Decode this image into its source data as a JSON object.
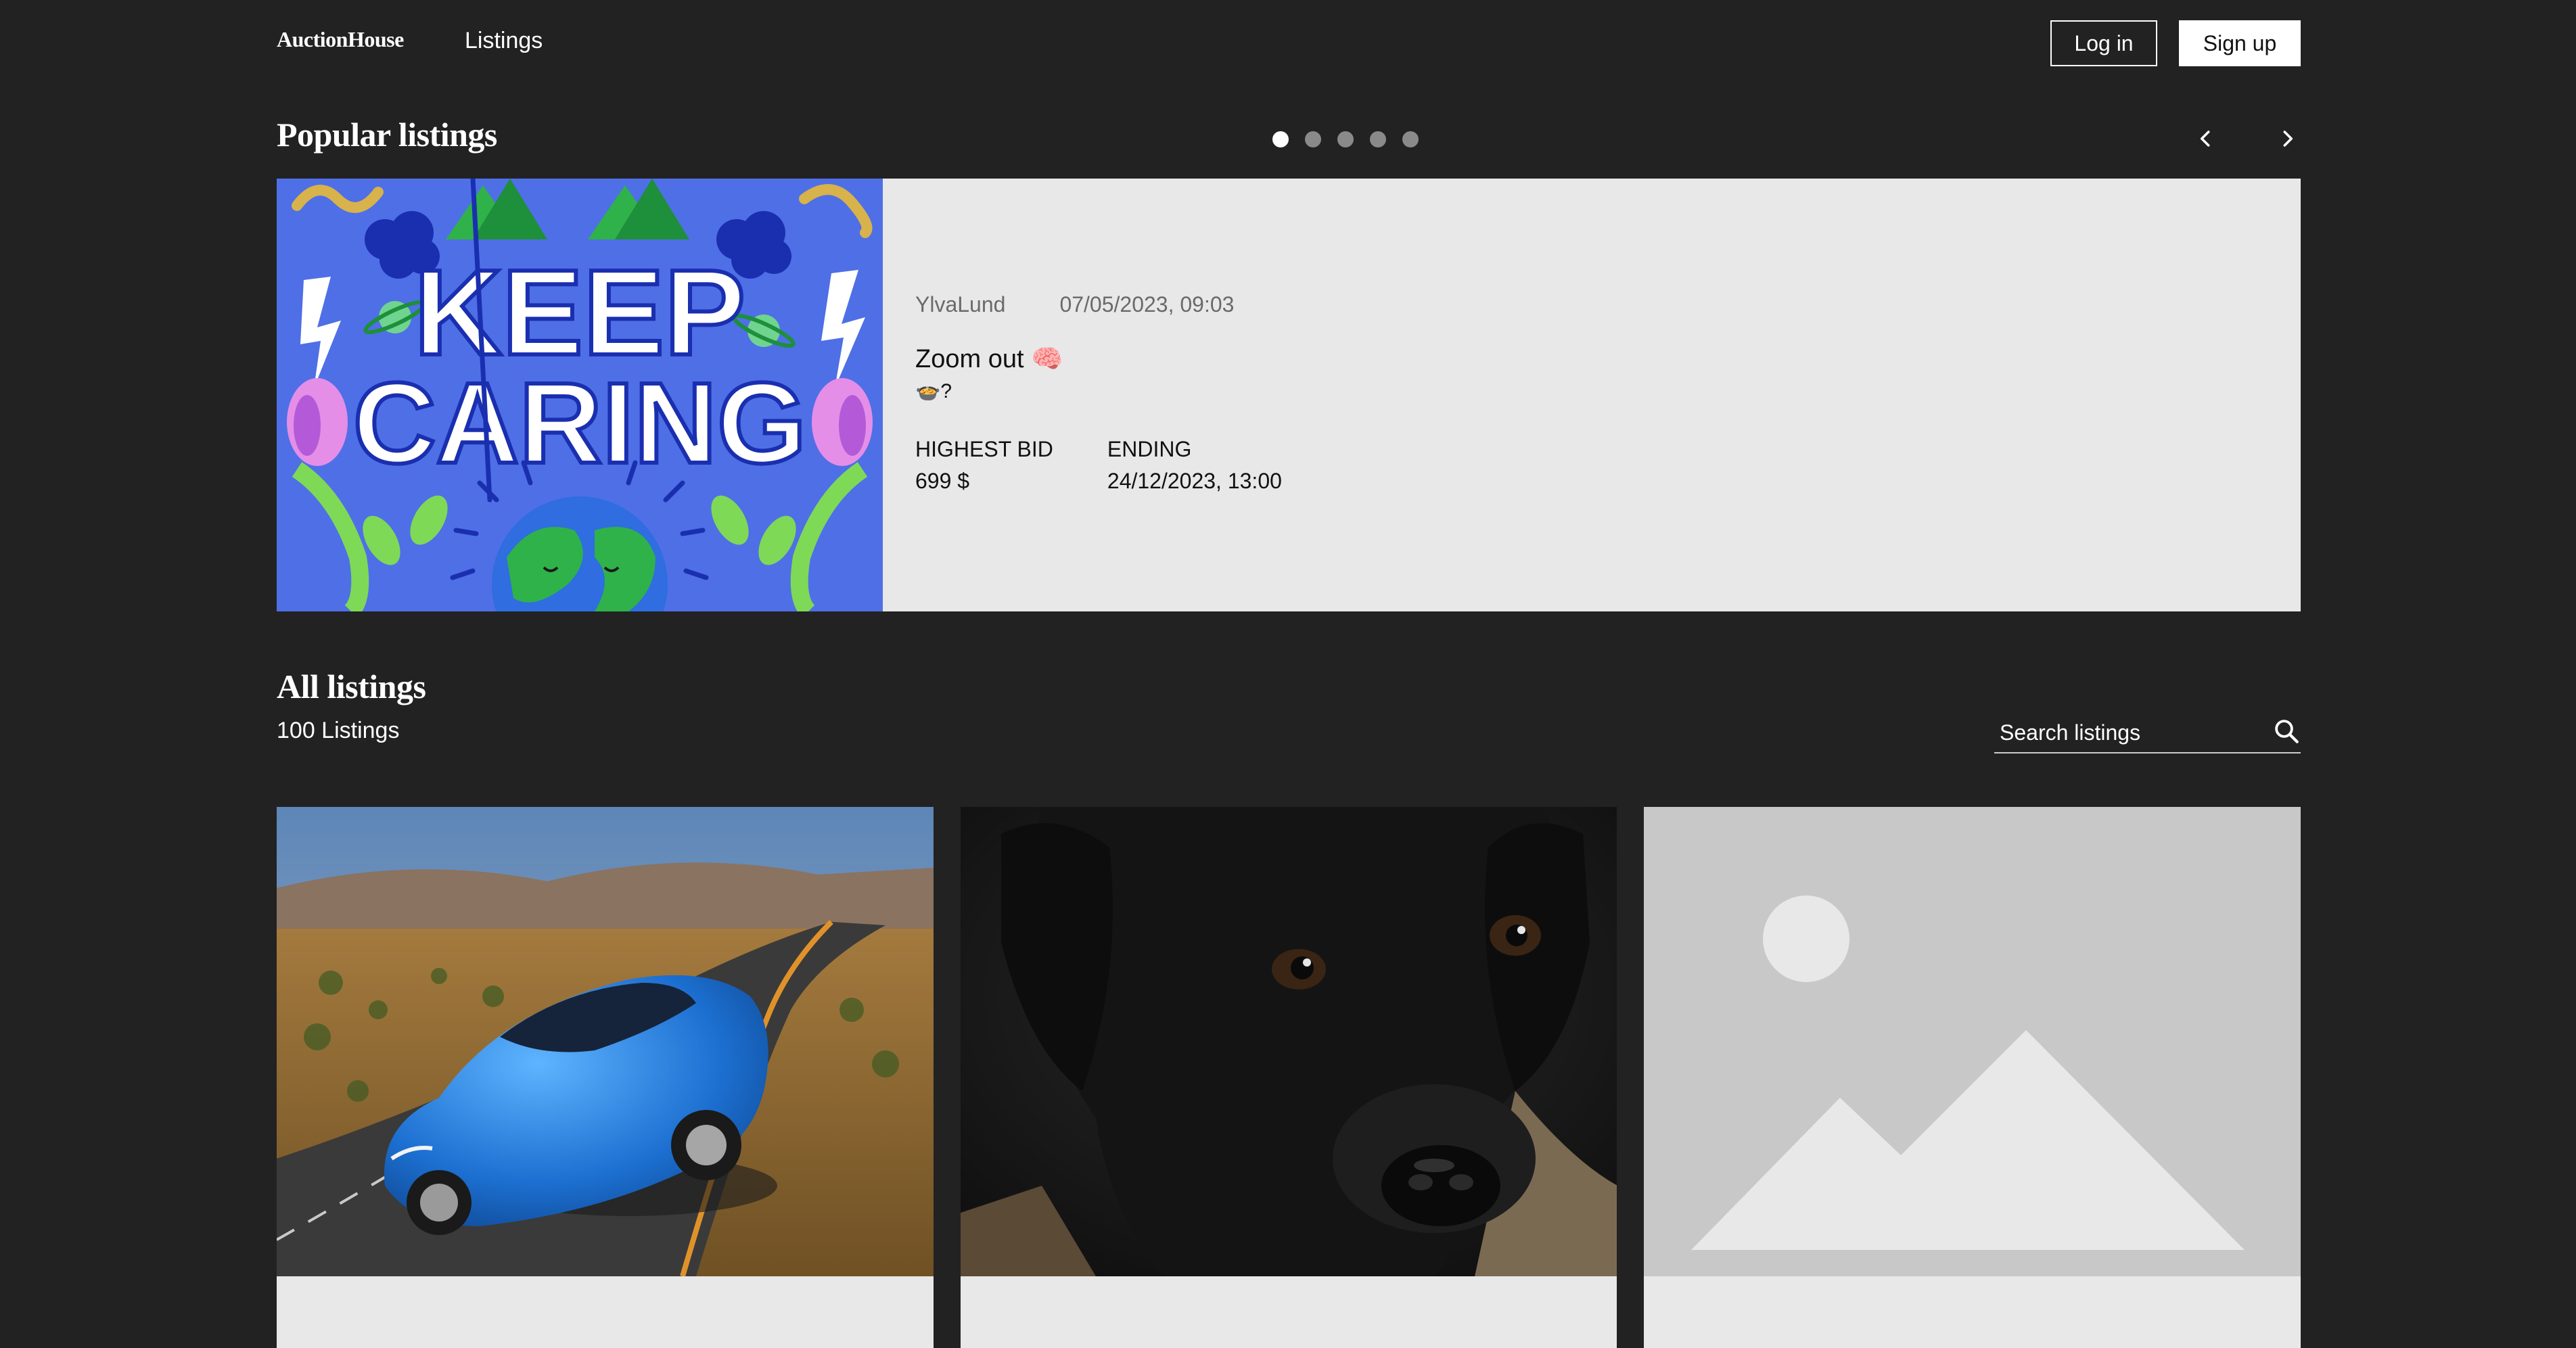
{
  "header": {
    "brand": "AuctionHouse",
    "nav_listings": "Listings",
    "login_label": "Log in",
    "signup_label": "Sign up"
  },
  "popular": {
    "title": "Popular listings",
    "dots": 5,
    "active_dot": 1,
    "prev_icon": "chevron-left-icon",
    "next_icon": "chevron-right-icon",
    "featured": {
      "image_text": [
        "KEEP",
        "CARING"
      ],
      "seller": "YlvaLund",
      "created": "07/05/2023, 09:03",
      "title": "Zoom out 🧠",
      "description": "🍲?",
      "highest_bid_label": "HIGHEST BID",
      "highest_bid_value": "699 $",
      "ending_label": "ENDING",
      "ending_value": "24/12/2023, 13:00"
    }
  },
  "all": {
    "title": "All listings",
    "count": "100 Listings",
    "search_placeholder": "Search listings",
    "search_icon": "search-icon",
    "cards": [
      {
        "image": "blue-sports-car"
      },
      {
        "image": "black-puppy"
      },
      {
        "image": "placeholder-image"
      }
    ]
  },
  "colors": {
    "background": "#222222",
    "panel": "#e8e8e8",
    "featured_image_bg": "#4f6fe6",
    "placeholder_bg": "#c8c8c8"
  }
}
